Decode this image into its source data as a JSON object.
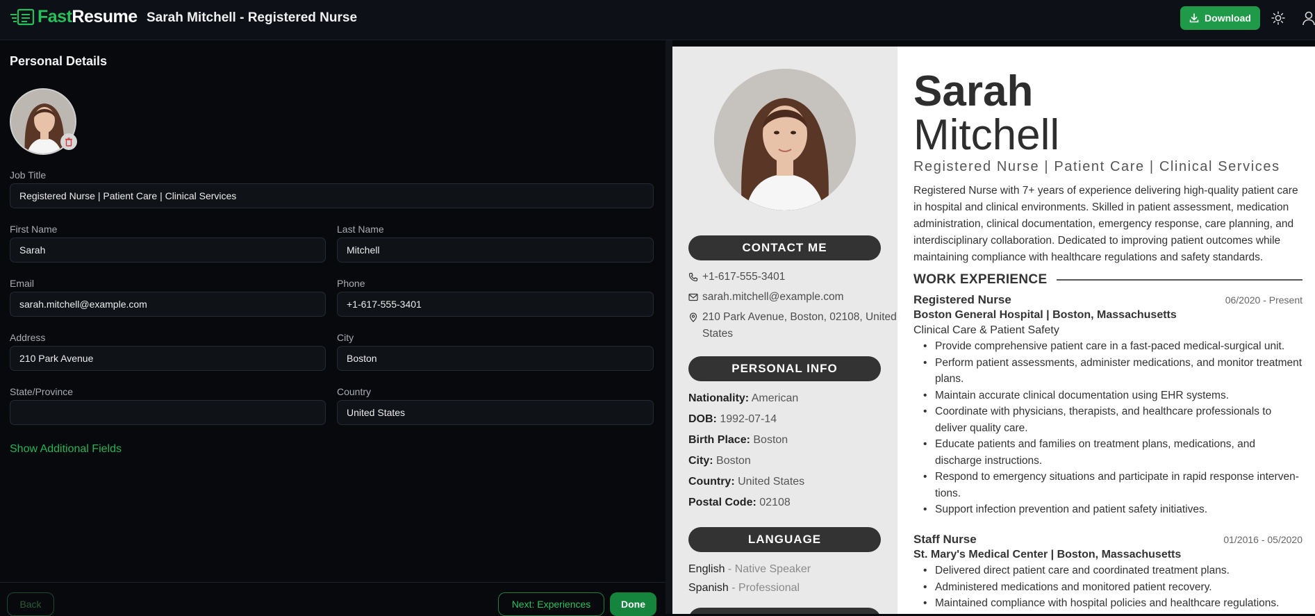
{
  "app": {
    "logo_part1": "Fast",
    "logo_part2": "Resume",
    "doc_title": "Sarah Mitchell - Registered Nurse",
    "download_label": "Download",
    "accent_color": "#1f9a48"
  },
  "form": {
    "section_title": "Personal Details",
    "fields": {
      "job_title": {
        "label": "Job Title",
        "value": "Registered Nurse | Patient Care | Clinical Services"
      },
      "first_name": {
        "label": "First Name",
        "value": "Sarah"
      },
      "last_name": {
        "label": "Last Name",
        "value": "Mitchell"
      },
      "email": {
        "label": "Email",
        "value": "sarah.mitchell@example.com"
      },
      "phone": {
        "label": "Phone",
        "value": "+1-617-555-3401"
      },
      "address": {
        "label": "Address",
        "value": "210 Park Avenue"
      },
      "city": {
        "label": "City",
        "value": "Boston"
      },
      "state": {
        "label": "State/Province",
        "value": ""
      },
      "country": {
        "label": "Country",
        "value": "United States"
      }
    },
    "show_more": "Show Additional Fields",
    "back_label": "Back",
    "next_label": "Next: Experiences",
    "done_label": "Done"
  },
  "resume": {
    "first_name": "Sarah",
    "last_name": "Mitchell",
    "role": "Registered Nurse | Patient Care | Clinical Services",
    "summary": "Registered Nurse with 7+ years of experience delivering high-quality patient care in hospital and clinical environments. Skilled in patient assessment, medication administration, clinical documentation, emergency response, care planning, and interdisciplinary collaboration. Dedicated to improving patient outcomes while maintaining compliance with healthcare regulations and safety standards.",
    "contact_heading": "CONTACT ME",
    "contact": {
      "phone": "+1-617-555-3401",
      "email": "sarah.mitchell@example.com",
      "address": "210 Park Avenue, Boston, 02108, United States"
    },
    "personal_heading": "PERSONAL INFO",
    "personal": [
      {
        "label": "Nationality:",
        "value": "American"
      },
      {
        "label": "DOB:",
        "value": "1992-07-14"
      },
      {
        "label": "Birth Place:",
        "value": "Boston"
      },
      {
        "label": "City:",
        "value": "Boston"
      },
      {
        "label": "Country:",
        "value": "United States"
      },
      {
        "label": "Postal Code:",
        "value": "02108"
      }
    ],
    "language_heading": "LANGUAGE",
    "languages": [
      {
        "name": "English",
        "level": " - Native Speaker"
      },
      {
        "name": "Spanish",
        "level": " - Professional"
      }
    ],
    "work_heading": "WORK EXPERIENCE",
    "jobs": [
      {
        "title": "Registered Nurse",
        "date": "06/2020 - Present",
        "company": "Boston General Hospital | Boston, Massachusetts",
        "subtitle": "Clinical Care & Patient Safety",
        "bullets": [
          "Provide comprehensive patient care in a fast-paced medical-surgical unit.",
          "Perform patient assessments, administer medications, and monitor treatment plans.",
          "Maintain accurate clinical documentation using EHR systems.",
          "Coordinate with physicians, therapists, and healthcare professionals to deliver quality care.",
          "Educate patients and families on treatment plans, medications, and discharge instructions.",
          "Respond to emergency situations and participate in rapid response interven- tions.",
          "Support infection prevention and patient safety initiatives."
        ]
      },
      {
        "title": "Staff Nurse",
        "date": "01/2016 - 05/2020",
        "company": "St. Mary's Medical Center | Boston, Massachusetts",
        "bullets": [
          "Delivered direct patient care and coordinated treatment plans.",
          "Administered medications and monitored patient recovery.",
          "Maintained compliance with hospital policies and healthcare regulations."
        ]
      }
    ]
  }
}
